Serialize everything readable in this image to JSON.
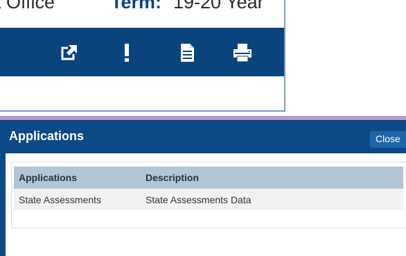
{
  "top_window": {
    "header": {
      "office_text": "t Office",
      "term_label": "Term:",
      "term_value": "19-20 Year"
    },
    "toolbar": {
      "buttons": [
        {
          "icon": "external-link-icon"
        },
        {
          "icon": "alert-icon"
        },
        {
          "icon": "document-icon"
        },
        {
          "icon": "printer-icon"
        }
      ]
    }
  },
  "dialog": {
    "title": "Applications",
    "close_label": "Close",
    "table": {
      "headers": [
        "Applications",
        "Description"
      ],
      "rows": [
        [
          "State Assessments",
          "State Assessments Data"
        ]
      ]
    }
  },
  "colors": {
    "toolbar_bg": "#0a447e",
    "dialog_header_bg": "#0b4a86",
    "table_header_bg": "#b1c6d6",
    "accent_border": "#b59ac7"
  }
}
